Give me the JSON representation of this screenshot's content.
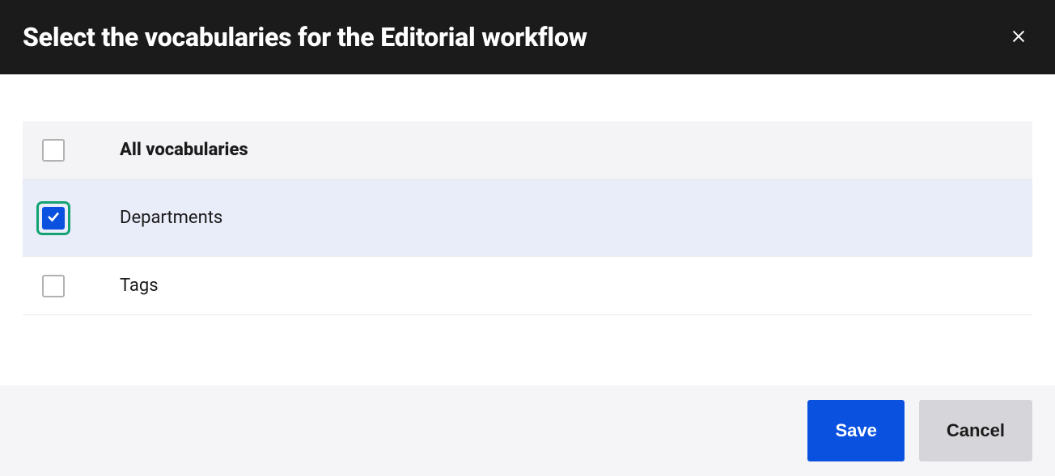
{
  "header": {
    "title": "Select the vocabularies for the Editorial workflow"
  },
  "rows": {
    "all": {
      "label": "All vocabularies",
      "checked": false
    },
    "departments": {
      "label": "Departments",
      "checked": true
    },
    "tags": {
      "label": "Tags",
      "checked": false
    }
  },
  "footer": {
    "save_label": "Save",
    "cancel_label": "Cancel"
  }
}
